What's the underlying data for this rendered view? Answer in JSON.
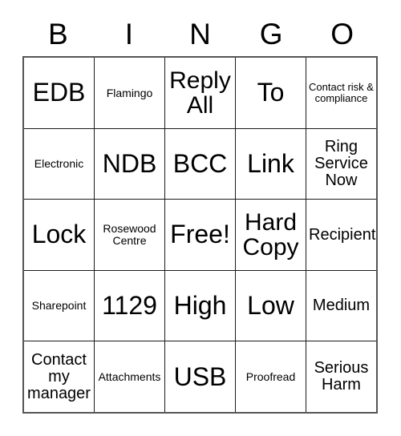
{
  "card": {
    "title": "BINGO",
    "header_letters": [
      "B",
      "I",
      "N",
      "G",
      "O"
    ],
    "columns": 5,
    "rows": 5,
    "border_color": "#555555",
    "grid_line_color": "#1a1a1a",
    "background_color": "#ffffff",
    "text_color": "#000000",
    "free_space": "Free!",
    "cells": [
      [
        {
          "text": "EDB",
          "size": "xl"
        },
        {
          "text": "Flamingo",
          "size": "sm"
        },
        {
          "text": "Reply All",
          "size": "lg"
        },
        {
          "text": "To",
          "size": "xl"
        },
        {
          "text": "Contact risk & compliance",
          "size": "xs"
        }
      ],
      [
        {
          "text": "Electronic",
          "size": "sm"
        },
        {
          "text": "NDB",
          "size": "xl"
        },
        {
          "text": "BCC",
          "size": "xl"
        },
        {
          "text": "Link",
          "size": "xl"
        },
        {
          "text": "Ring Service Now",
          "size": "md"
        }
      ],
      [
        {
          "text": "Lock",
          "size": "xl"
        },
        {
          "text": "Rosewood Centre",
          "size": "sm"
        },
        {
          "text": "Free!",
          "size": "xl"
        },
        {
          "text": "Hard Copy",
          "size": "lg"
        },
        {
          "text": "Recipient",
          "size": "md"
        }
      ],
      [
        {
          "text": "Sharepoint",
          "size": "sm"
        },
        {
          "text": "1129",
          "size": "xl"
        },
        {
          "text": "High",
          "size": "xl"
        },
        {
          "text": "Low",
          "size": "xl"
        },
        {
          "text": "Medium",
          "size": "md"
        }
      ],
      [
        {
          "text": "Contact my manager",
          "size": "md"
        },
        {
          "text": "Attachments",
          "size": "sm"
        },
        {
          "text": "USB",
          "size": "xl"
        },
        {
          "text": "Proofread",
          "size": "sm"
        },
        {
          "text": "Serious Harm",
          "size": "md"
        }
      ]
    ]
  }
}
